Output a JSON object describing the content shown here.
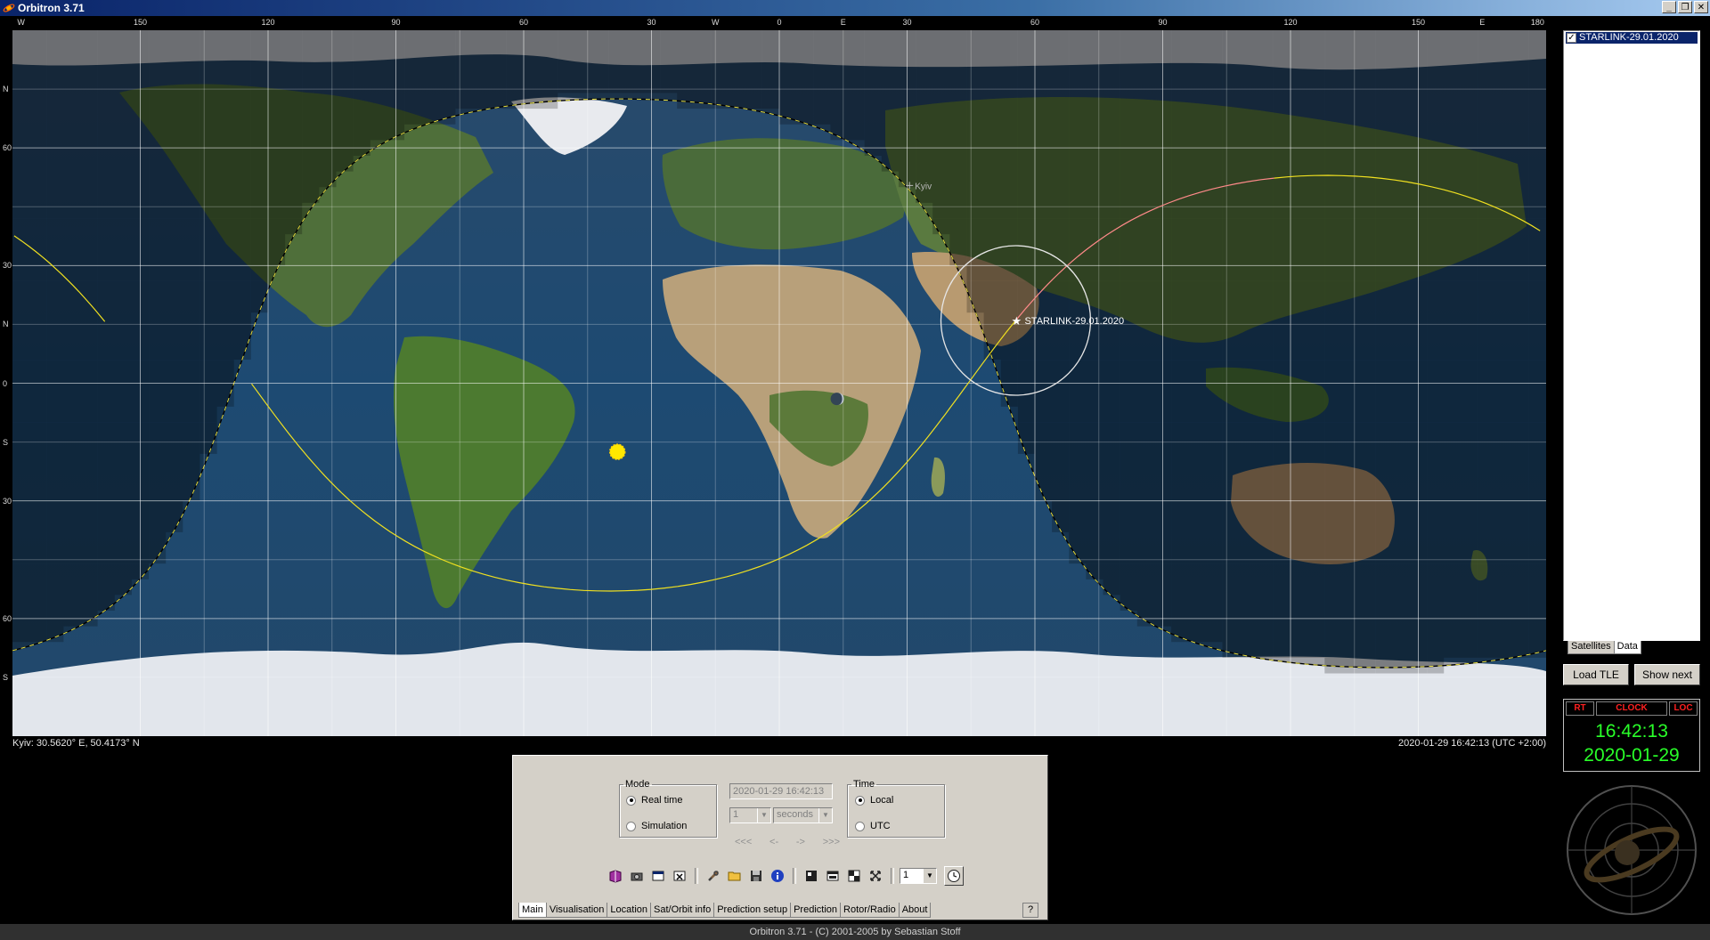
{
  "app": {
    "title": "Orbitron 3.71",
    "footer": "Orbitron 3.71 - (C) 2001-2005 by Sebastian Stoff"
  },
  "window_buttons": [
    "_",
    "❐",
    "✕"
  ],
  "rulers": {
    "longitude": [
      {
        "label": "W",
        "lon": -178
      },
      {
        "label": "150",
        "lon": -150
      },
      {
        "label": "120",
        "lon": -120
      },
      {
        "label": "90",
        "lon": -90
      },
      {
        "label": "60",
        "lon": -60
      },
      {
        "label": "30",
        "lon": -30
      },
      {
        "label": "W",
        "lon": -15
      },
      {
        "label": "0",
        "lon": 0
      },
      {
        "label": "E",
        "lon": 15
      },
      {
        "label": "30",
        "lon": 30
      },
      {
        "label": "60",
        "lon": 60
      },
      {
        "label": "90",
        "lon": 90
      },
      {
        "label": "120",
        "lon": 120
      },
      {
        "label": "150",
        "lon": 150
      },
      {
        "label": "E",
        "lon": 165
      },
      {
        "label": "180",
        "lon": 178
      }
    ],
    "latitude": [
      {
        "label": "N",
        "lat": 75
      },
      {
        "label": "60",
        "lat": 60
      },
      {
        "label": "30",
        "lat": 30
      },
      {
        "label": "N",
        "lat": 15
      },
      {
        "label": "0",
        "lat": 0
      },
      {
        "label": "S",
        "lat": -15
      },
      {
        "label": "30",
        "lat": -30
      },
      {
        "label": "60",
        "lat": -60
      },
      {
        "label": "S",
        "lat": -75
      }
    ]
  },
  "map": {
    "location_label": "Kyiv",
    "location": {
      "lon": 30.562,
      "lat": 50.417
    },
    "satellite_label": "STARLINK-29.01.2020",
    "satellite_position": {
      "lon": 55.5,
      "lat": 16.0
    },
    "sun_position": {
      "lon": -38,
      "lat": -17.5
    },
    "moon_position": {
      "lon": 13.5,
      "lat": -4
    }
  },
  "status": {
    "observer": "Kyiv: 30.5620° E, 50.4173° N",
    "datetime": "2020-01-29 16:42:13 (UTC +2:00)"
  },
  "controls": {
    "mode_legend": "Mode",
    "realtime_label": "Real time",
    "simulation_label": "Simulation",
    "datetime_value": "2020-01-29 16:42:13",
    "step_value": "1",
    "step_unit": "seconds",
    "step_nav": [
      "<<<",
      "<-",
      "->",
      ">>>"
    ],
    "time_legend": "Time",
    "local_label": "Local",
    "utc_label": "UTC",
    "zoom_value": "1",
    "tabs": [
      "Main",
      "Visualisation",
      "Location",
      "Sat/Orbit info",
      "Prediction setup",
      "Prediction",
      "Rotor/Radio",
      "About"
    ],
    "help": "?"
  },
  "sidebar": {
    "sat_item": "STARLINK-29.01.2020",
    "tabs": [
      "Satellites",
      "Data"
    ],
    "load_tle": "Load TLE",
    "show_next": "Show next"
  },
  "clock": {
    "headers": [
      "RT",
      "CLOCK",
      "LOC"
    ],
    "time": "16:42:13",
    "date": "2020-01-29"
  }
}
